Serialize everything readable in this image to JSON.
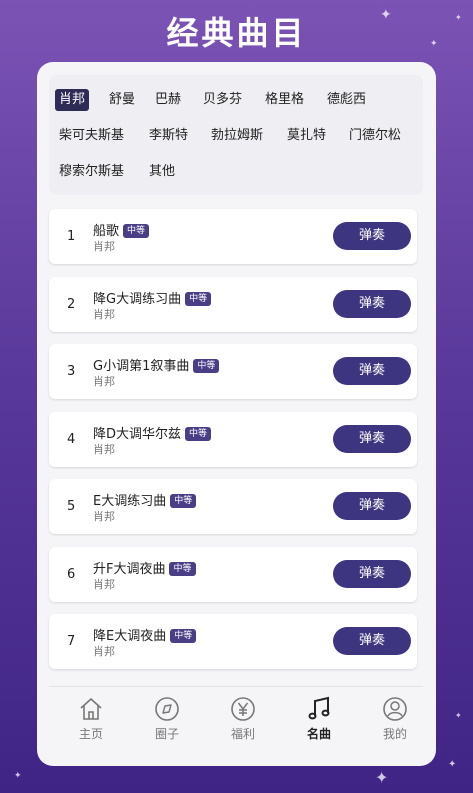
{
  "page_title": "经典曲目",
  "composers": [
    "肖邦",
    "舒曼",
    "巴赫",
    "贝多芬",
    "格里格",
    "德彪西",
    "柴可夫斯基",
    "李斯特",
    "勃拉姆斯",
    "莫扎特",
    "门德尔松",
    "穆索尔斯基",
    "其他"
  ],
  "selected_composer": "肖邦",
  "play_label": "弹奏",
  "pieces": [
    {
      "num": "1",
      "title": "船歌",
      "level": "中等",
      "composer": "肖邦"
    },
    {
      "num": "2",
      "title": "降G大调练习曲",
      "level": "中等",
      "composer": "肖邦"
    },
    {
      "num": "3",
      "title": "G小调第1叙事曲",
      "level": "中等",
      "composer": "肖邦"
    },
    {
      "num": "4",
      "title": "降D大调华尔兹",
      "level": "中等",
      "composer": "肖邦"
    },
    {
      "num": "5",
      "title": "E大调练习曲",
      "level": "中等",
      "composer": "肖邦"
    },
    {
      "num": "6",
      "title": "升F大调夜曲",
      "level": "中等",
      "composer": "肖邦"
    },
    {
      "num": "7",
      "title": "降E大调夜曲",
      "level": "中等",
      "composer": "肖邦"
    }
  ],
  "nav": [
    {
      "label": "主页",
      "icon": "home-icon"
    },
    {
      "label": "圈子",
      "icon": "compass-icon"
    },
    {
      "label": "福利",
      "icon": "yen-icon"
    },
    {
      "label": "名曲",
      "icon": "music-note-icon"
    },
    {
      "label": "我的",
      "icon": "user-icon"
    }
  ],
  "nav_active": "名曲",
  "colors": {
    "accent": "#3d3580",
    "chip_active": "#2f2b57",
    "badge": "#4a3f86"
  }
}
